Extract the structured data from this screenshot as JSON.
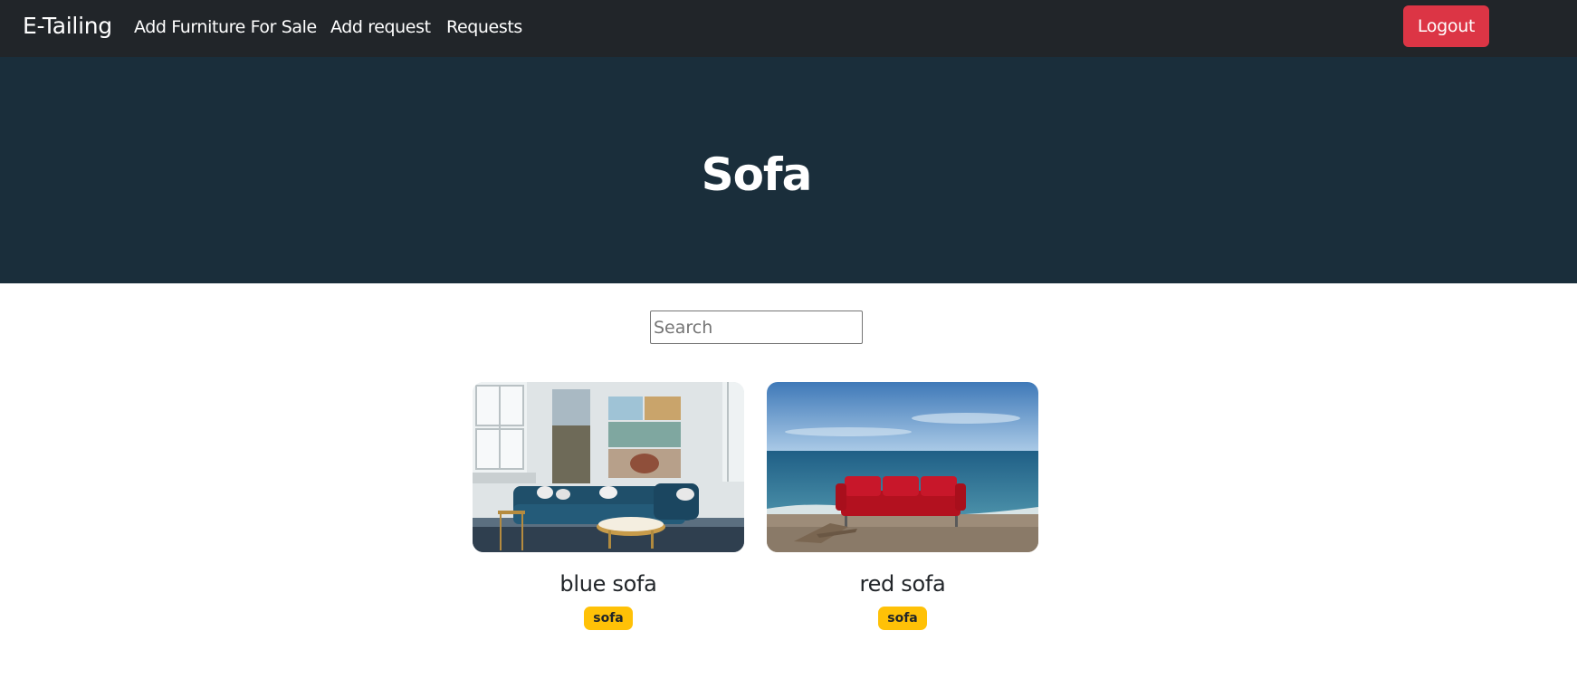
{
  "navbar": {
    "brand": "E-Tailing",
    "links": [
      "Add Furniture For Sale",
      "Add request",
      "Requests"
    ],
    "logout_label": "Logout"
  },
  "hero": {
    "title": "Sofa"
  },
  "search": {
    "placeholder": "Search",
    "value": ""
  },
  "products": [
    {
      "title": "blue sofa",
      "category": "sofa",
      "image": "blue-sofa-living-room-photo"
    },
    {
      "title": "red sofa",
      "category": "sofa",
      "image": "red-sofa-on-beach-photo"
    }
  ],
  "colors": {
    "navbar_bg": "#212529",
    "hero_bg": "#1a2e3b",
    "logout_bg": "#dc3545",
    "badge_bg": "#ffc107"
  }
}
